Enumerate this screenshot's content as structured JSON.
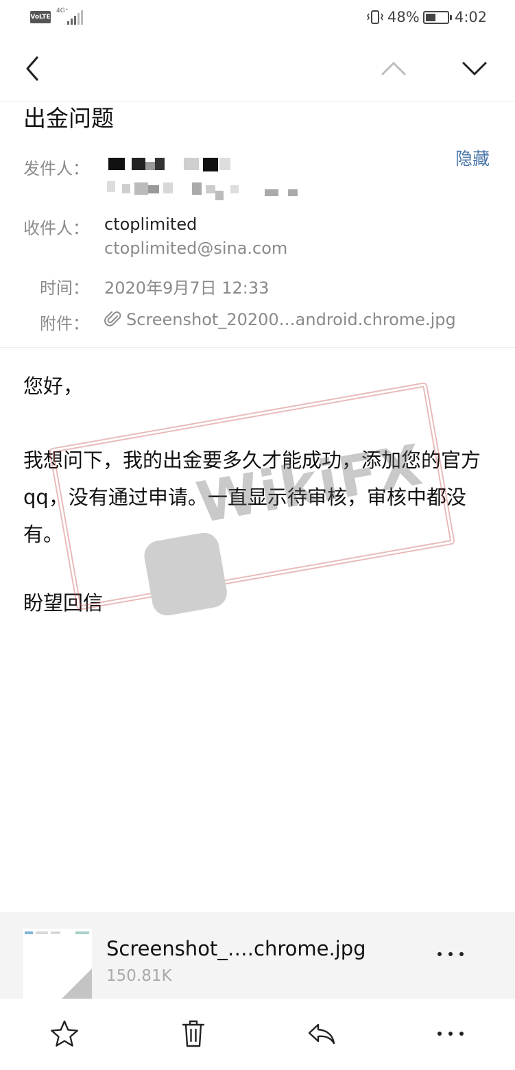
{
  "status_bar": {
    "volte": "VoLTE",
    "network": "4G⁺",
    "battery_percent": "48%",
    "battery_level": 0.48,
    "time": "4:02"
  },
  "email": {
    "subject": "出金问题",
    "hide_label": "隐藏",
    "from_label": "发件人：",
    "to_label": "收件人：",
    "to_name": "ctoplimited",
    "to_address": "ctoplimited@sina.com",
    "time_label": "时间：",
    "time_value": "2020年9月7日 12:33",
    "attachment_label": "附件：",
    "attachment_value": "Screenshot_20200…android.chrome.jpg",
    "body": {
      "greeting": "您好，",
      "paragraph": "我想问下，我的出金要多久才能成功，添加您的官方qq，没有通过申请。一直显示待审核，审核中都没有。",
      "closing": "盼望回信"
    }
  },
  "attachment_card": {
    "file_name": "Screenshot_….chrome.jpg",
    "file_size": "150.81K"
  },
  "watermark": {
    "brand": "WikiFX"
  },
  "colors": {
    "link": "#4a76a8",
    "label_grey": "#8a8a8a",
    "card_bg": "#f4f4f4"
  },
  "icons": {
    "back": "chevron-left-icon",
    "prev": "chevron-up-icon",
    "next": "chevron-down-icon",
    "attachment": "paperclip-icon",
    "more": "more-horizontal-icon",
    "star": "star-icon",
    "delete": "trash-icon",
    "reply": "reply-icon"
  }
}
